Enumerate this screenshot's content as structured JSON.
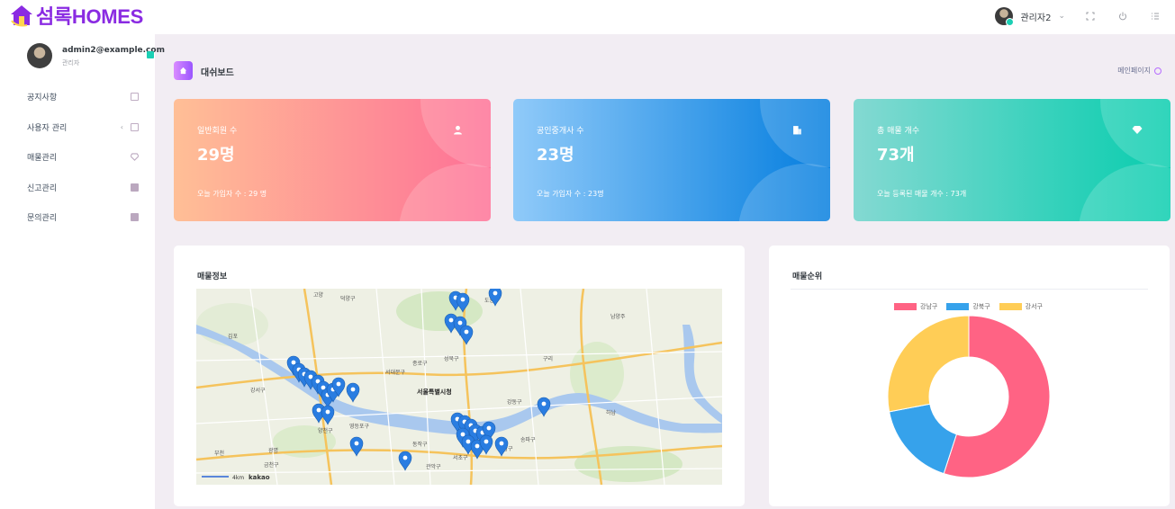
{
  "app": {
    "brand": "섬록HOMES"
  },
  "topbar": {
    "user_name": "관리자2"
  },
  "sidebar": {
    "email": "admin2@example.com",
    "role": "관리자",
    "items": [
      {
        "label": "공지사항",
        "icon": "notice-icon"
      },
      {
        "label": "사용자 관리",
        "icon": "user-manage-icon"
      },
      {
        "label": "매물관리",
        "icon": "diamond-icon"
      },
      {
        "label": "신고관리",
        "icon": "report-icon"
      },
      {
        "label": "문의관리",
        "icon": "inquiry-icon"
      }
    ]
  },
  "page": {
    "title": "대쉬보드",
    "breadcrumb": "메인페이지"
  },
  "stats": [
    {
      "label": "일반회원 수",
      "value": "29명",
      "foot": "오늘 가입자 수 : 29 명",
      "icon": "person-icon"
    },
    {
      "label": "공인중개사 수",
      "value": "23명",
      "foot": "오늘 가입자 수 : 23명",
      "icon": "building-icon"
    },
    {
      "label": "총 매물 개수",
      "value": "73개",
      "foot": "오늘 등록된 매물 개수 : 73개",
      "icon": "diamond-icon"
    }
  ],
  "map_card": {
    "title": "매물정보",
    "labels": [
      "고양",
      "덕양구",
      "김포",
      "종로구",
      "성북구",
      "도봉구",
      "남양주",
      "서대문구",
      "구리",
      "강서구",
      "서울특별시청",
      "강동구",
      "하남",
      "양천구",
      "영등포구",
      "동작구",
      "관악구",
      "송파구",
      "강남구",
      "서초구",
      "부천",
      "광명",
      "금천구"
    ],
    "scale": "4km",
    "attribution": "kakao"
  },
  "rank_card": {
    "title": "매물순위"
  },
  "chart_data": {
    "type": "pie",
    "donut": true,
    "categories": [
      "강남구",
      "강북구",
      "강서구"
    ],
    "values": [
      55,
      17,
      28
    ],
    "colors": [
      "#ff6384",
      "#36a2eb",
      "#ffcd56"
    ],
    "legend": "top"
  },
  "colors": {
    "accent": "#9a55ff"
  }
}
